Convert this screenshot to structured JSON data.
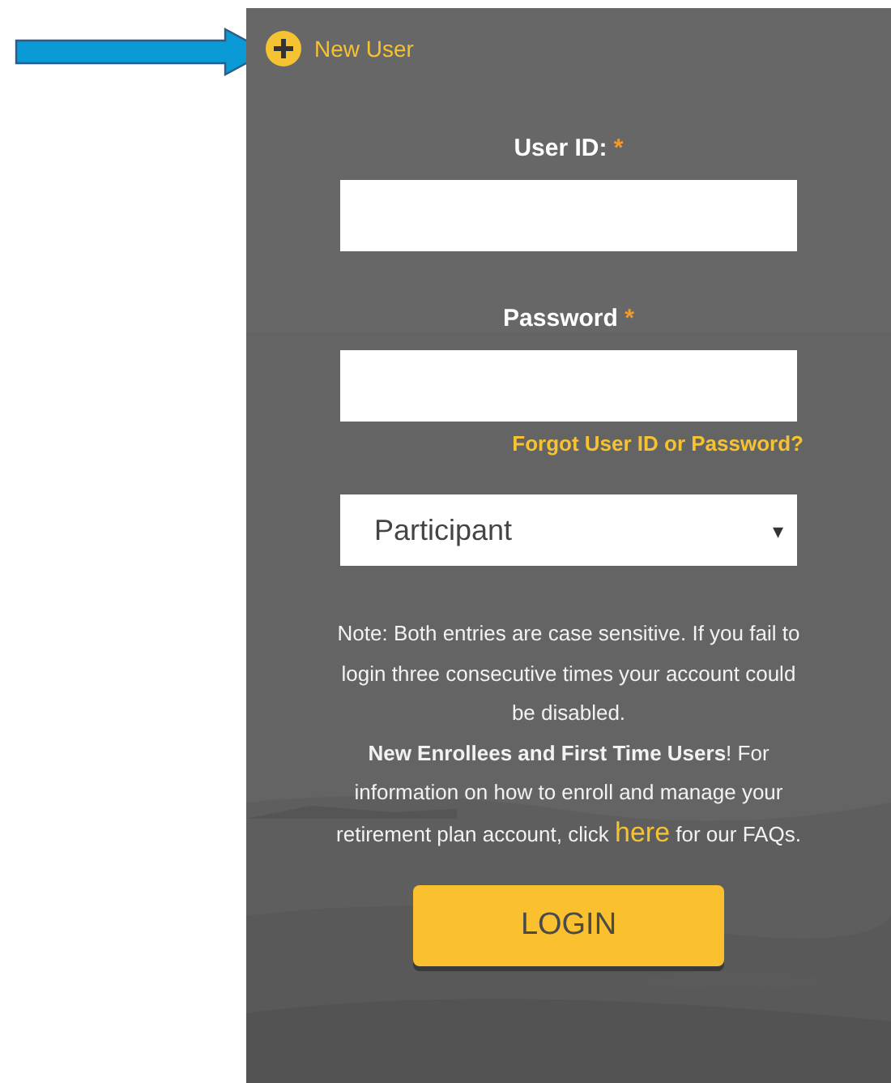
{
  "new_user_link": {
    "label": "New User"
  },
  "fields": [
    {
      "label": "User ID:",
      "required_mark": "*"
    },
    {
      "label": "Password",
      "required_mark": "*"
    }
  ],
  "forgot_link": "Forgot User ID or Password?",
  "role_select": {
    "value": "Participant",
    "caret": "▾"
  },
  "note": "Note: Both entries are case sensitive. If you fail to login three consecutive times your account could be disabled.",
  "enrollee_note": {
    "before": "**New Enrollees and First Time Users**! For information on how to enroll and manage your retirement plan account, click ",
    "link": "here",
    "after": " for our FAQs."
  },
  "login_button": "LOGIN"
}
